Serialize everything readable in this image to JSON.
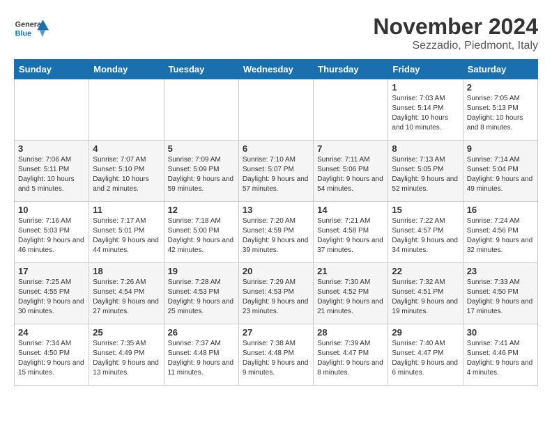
{
  "header": {
    "logo_general": "General",
    "logo_blue": "Blue",
    "month_title": "November 2024",
    "location": "Sezzadio, Piedmont, Italy"
  },
  "days_of_week": [
    "Sunday",
    "Monday",
    "Tuesday",
    "Wednesday",
    "Thursday",
    "Friday",
    "Saturday"
  ],
  "weeks": [
    [
      {
        "day": "",
        "info": ""
      },
      {
        "day": "",
        "info": ""
      },
      {
        "day": "",
        "info": ""
      },
      {
        "day": "",
        "info": ""
      },
      {
        "day": "",
        "info": ""
      },
      {
        "day": "1",
        "info": "Sunrise: 7:03 AM\nSunset: 5:14 PM\nDaylight: 10 hours and 10 minutes."
      },
      {
        "day": "2",
        "info": "Sunrise: 7:05 AM\nSunset: 5:13 PM\nDaylight: 10 hours and 8 minutes."
      }
    ],
    [
      {
        "day": "3",
        "info": "Sunrise: 7:06 AM\nSunset: 5:11 PM\nDaylight: 10 hours and 5 minutes."
      },
      {
        "day": "4",
        "info": "Sunrise: 7:07 AM\nSunset: 5:10 PM\nDaylight: 10 hours and 2 minutes."
      },
      {
        "day": "5",
        "info": "Sunrise: 7:09 AM\nSunset: 5:09 PM\nDaylight: 9 hours and 59 minutes."
      },
      {
        "day": "6",
        "info": "Sunrise: 7:10 AM\nSunset: 5:07 PM\nDaylight: 9 hours and 57 minutes."
      },
      {
        "day": "7",
        "info": "Sunrise: 7:11 AM\nSunset: 5:06 PM\nDaylight: 9 hours and 54 minutes."
      },
      {
        "day": "8",
        "info": "Sunrise: 7:13 AM\nSunset: 5:05 PM\nDaylight: 9 hours and 52 minutes."
      },
      {
        "day": "9",
        "info": "Sunrise: 7:14 AM\nSunset: 5:04 PM\nDaylight: 9 hours and 49 minutes."
      }
    ],
    [
      {
        "day": "10",
        "info": "Sunrise: 7:16 AM\nSunset: 5:03 PM\nDaylight: 9 hours and 46 minutes."
      },
      {
        "day": "11",
        "info": "Sunrise: 7:17 AM\nSunset: 5:01 PM\nDaylight: 9 hours and 44 minutes."
      },
      {
        "day": "12",
        "info": "Sunrise: 7:18 AM\nSunset: 5:00 PM\nDaylight: 9 hours and 42 minutes."
      },
      {
        "day": "13",
        "info": "Sunrise: 7:20 AM\nSunset: 4:59 PM\nDaylight: 9 hours and 39 minutes."
      },
      {
        "day": "14",
        "info": "Sunrise: 7:21 AM\nSunset: 4:58 PM\nDaylight: 9 hours and 37 minutes."
      },
      {
        "day": "15",
        "info": "Sunrise: 7:22 AM\nSunset: 4:57 PM\nDaylight: 9 hours and 34 minutes."
      },
      {
        "day": "16",
        "info": "Sunrise: 7:24 AM\nSunset: 4:56 PM\nDaylight: 9 hours and 32 minutes."
      }
    ],
    [
      {
        "day": "17",
        "info": "Sunrise: 7:25 AM\nSunset: 4:55 PM\nDaylight: 9 hours and 30 minutes."
      },
      {
        "day": "18",
        "info": "Sunrise: 7:26 AM\nSunset: 4:54 PM\nDaylight: 9 hours and 27 minutes."
      },
      {
        "day": "19",
        "info": "Sunrise: 7:28 AM\nSunset: 4:53 PM\nDaylight: 9 hours and 25 minutes."
      },
      {
        "day": "20",
        "info": "Sunrise: 7:29 AM\nSunset: 4:53 PM\nDaylight: 9 hours and 23 minutes."
      },
      {
        "day": "21",
        "info": "Sunrise: 7:30 AM\nSunset: 4:52 PM\nDaylight: 9 hours and 21 minutes."
      },
      {
        "day": "22",
        "info": "Sunrise: 7:32 AM\nSunset: 4:51 PM\nDaylight: 9 hours and 19 minutes."
      },
      {
        "day": "23",
        "info": "Sunrise: 7:33 AM\nSunset: 4:50 PM\nDaylight: 9 hours and 17 minutes."
      }
    ],
    [
      {
        "day": "24",
        "info": "Sunrise: 7:34 AM\nSunset: 4:50 PM\nDaylight: 9 hours and 15 minutes."
      },
      {
        "day": "25",
        "info": "Sunrise: 7:35 AM\nSunset: 4:49 PM\nDaylight: 9 hours and 13 minutes."
      },
      {
        "day": "26",
        "info": "Sunrise: 7:37 AM\nSunset: 4:48 PM\nDaylight: 9 hours and 11 minutes."
      },
      {
        "day": "27",
        "info": "Sunrise: 7:38 AM\nSunset: 4:48 PM\nDaylight: 9 hours and 9 minutes."
      },
      {
        "day": "28",
        "info": "Sunrise: 7:39 AM\nSunset: 4:47 PM\nDaylight: 9 hours and 8 minutes."
      },
      {
        "day": "29",
        "info": "Sunrise: 7:40 AM\nSunset: 4:47 PM\nDaylight: 9 hours and 6 minutes."
      },
      {
        "day": "30",
        "info": "Sunrise: 7:41 AM\nSunset: 4:46 PM\nDaylight: 9 hours and 4 minutes."
      }
    ]
  ]
}
